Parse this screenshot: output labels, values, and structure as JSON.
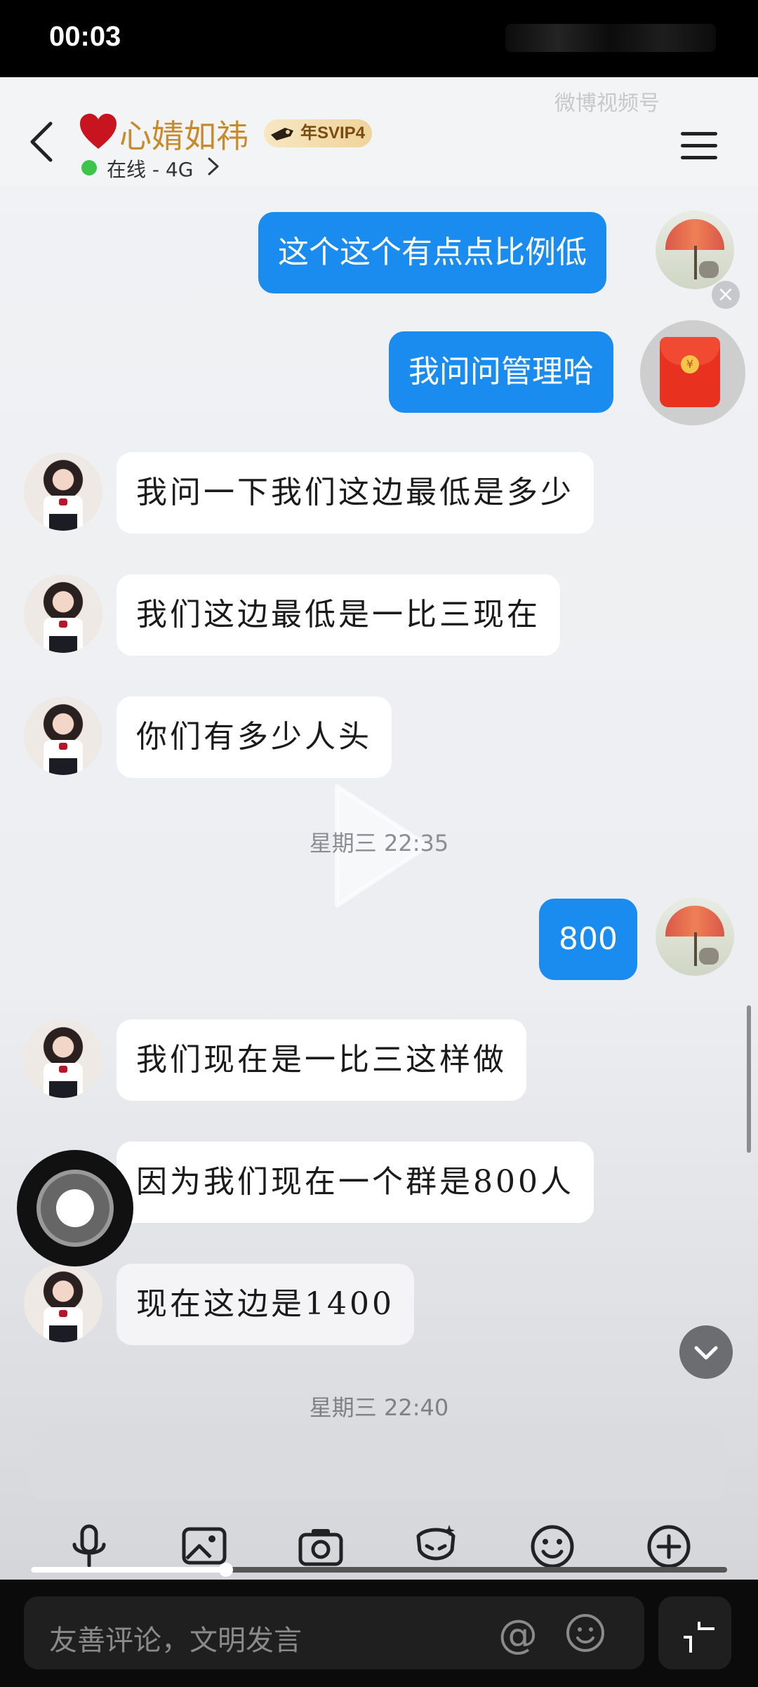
{
  "status_bar": {
    "time": "00:03"
  },
  "header": {
    "contact_name": "心婧如祎",
    "badge": "年SVIP4",
    "online_status": "在线 - 4G",
    "watermark": "微博视频号"
  },
  "messages": [
    {
      "side": "me",
      "text": "这个这个有点点比例低"
    },
    {
      "side": "me",
      "text": "我问问管理哈"
    },
    {
      "side": "them",
      "text": "我问一下我们这边最低是多少"
    },
    {
      "side": "them",
      "text": "我们这边最低是一比三现在"
    },
    {
      "side": "them",
      "text": "你们有多少人头"
    },
    {
      "side": "me",
      "text": "800"
    },
    {
      "side": "them",
      "text": "我们现在是一比三这样做"
    },
    {
      "side": "them",
      "text": "因为我们现在一个群是800人"
    },
    {
      "side": "them",
      "text": "现在这边是1400"
    }
  ],
  "time_separators": [
    "星期三 22:35",
    "星期三 22:40"
  ],
  "comment_bar": {
    "placeholder": "友善评论，文明发言",
    "at_symbol": "@"
  },
  "video_progress": 0.28,
  "colors": {
    "my_bubble": "#1a8cf0",
    "their_bubble": "#ffffff",
    "name": "#c98a2c",
    "online": "#3ec44a"
  },
  "icons": [
    "back-icon",
    "heart-icon",
    "rocket-icon",
    "chevron-right-icon",
    "menu-icon",
    "red-packet-icon",
    "close-icon",
    "play-icon",
    "chevron-down-icon",
    "microphone-icon",
    "image-icon",
    "camera-icon",
    "sticker-icon",
    "smiley-icon",
    "plus-icon",
    "at-icon",
    "emoji-icon",
    "expand-icon"
  ]
}
